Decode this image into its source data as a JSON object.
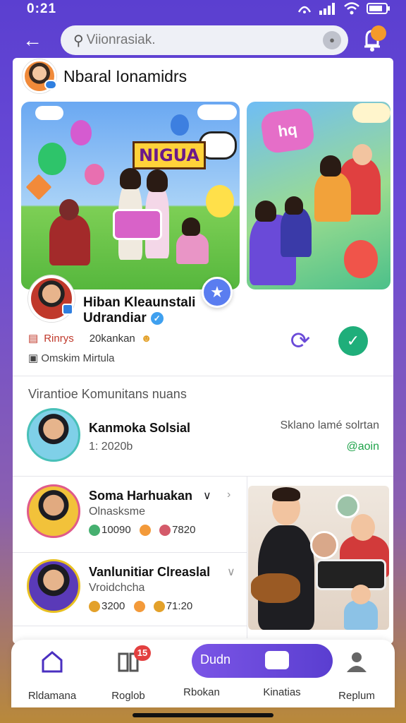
{
  "status_bar": {
    "time": "0:21"
  },
  "header": {
    "search_placeholder": "Viionrasiak.",
    "search_value": ""
  },
  "community": {
    "name": "Nbaral Ionamidrs"
  },
  "banner_1": {
    "sign_text": "NIGUA"
  },
  "banner_2": {
    "bubble_text": "hq"
  },
  "profile": {
    "name": "Hiban Kleaunstali Udrandiar",
    "tag": "Rinrys",
    "count": "20kankan",
    "location": "Omskim Mirtula"
  },
  "section": {
    "title": "Virantioe Komunitans nuans"
  },
  "members": [
    {
      "name": "Kanmoka Solsial",
      "sub": "1: 2020b",
      "right_label": "Sklano lamé solrtan",
      "status": "@aoin"
    },
    {
      "name": "Soma Harhuakan",
      "sub": "Olnasksme",
      "stats_a": "10090",
      "stats_b": "7820"
    },
    {
      "name": "Vanlunitiar Clreaslal",
      "sub": "Vroidchcha",
      "stats_a": "3200",
      "stats_b": "71:20"
    }
  ],
  "bottom_nav": {
    "items": [
      {
        "label": "Rldamana"
      },
      {
        "label": "Roglob",
        "badge": "15"
      },
      {
        "label": "Rbokan"
      },
      {
        "label": "Kinatias"
      },
      {
        "label": "Replum"
      }
    ],
    "pill_text": "Dudn"
  },
  "colors": {
    "accent": "#6a4ad8",
    "verified": "#3fa0ef",
    "online": "#1fa34a",
    "confirm": "#1fae7a"
  }
}
